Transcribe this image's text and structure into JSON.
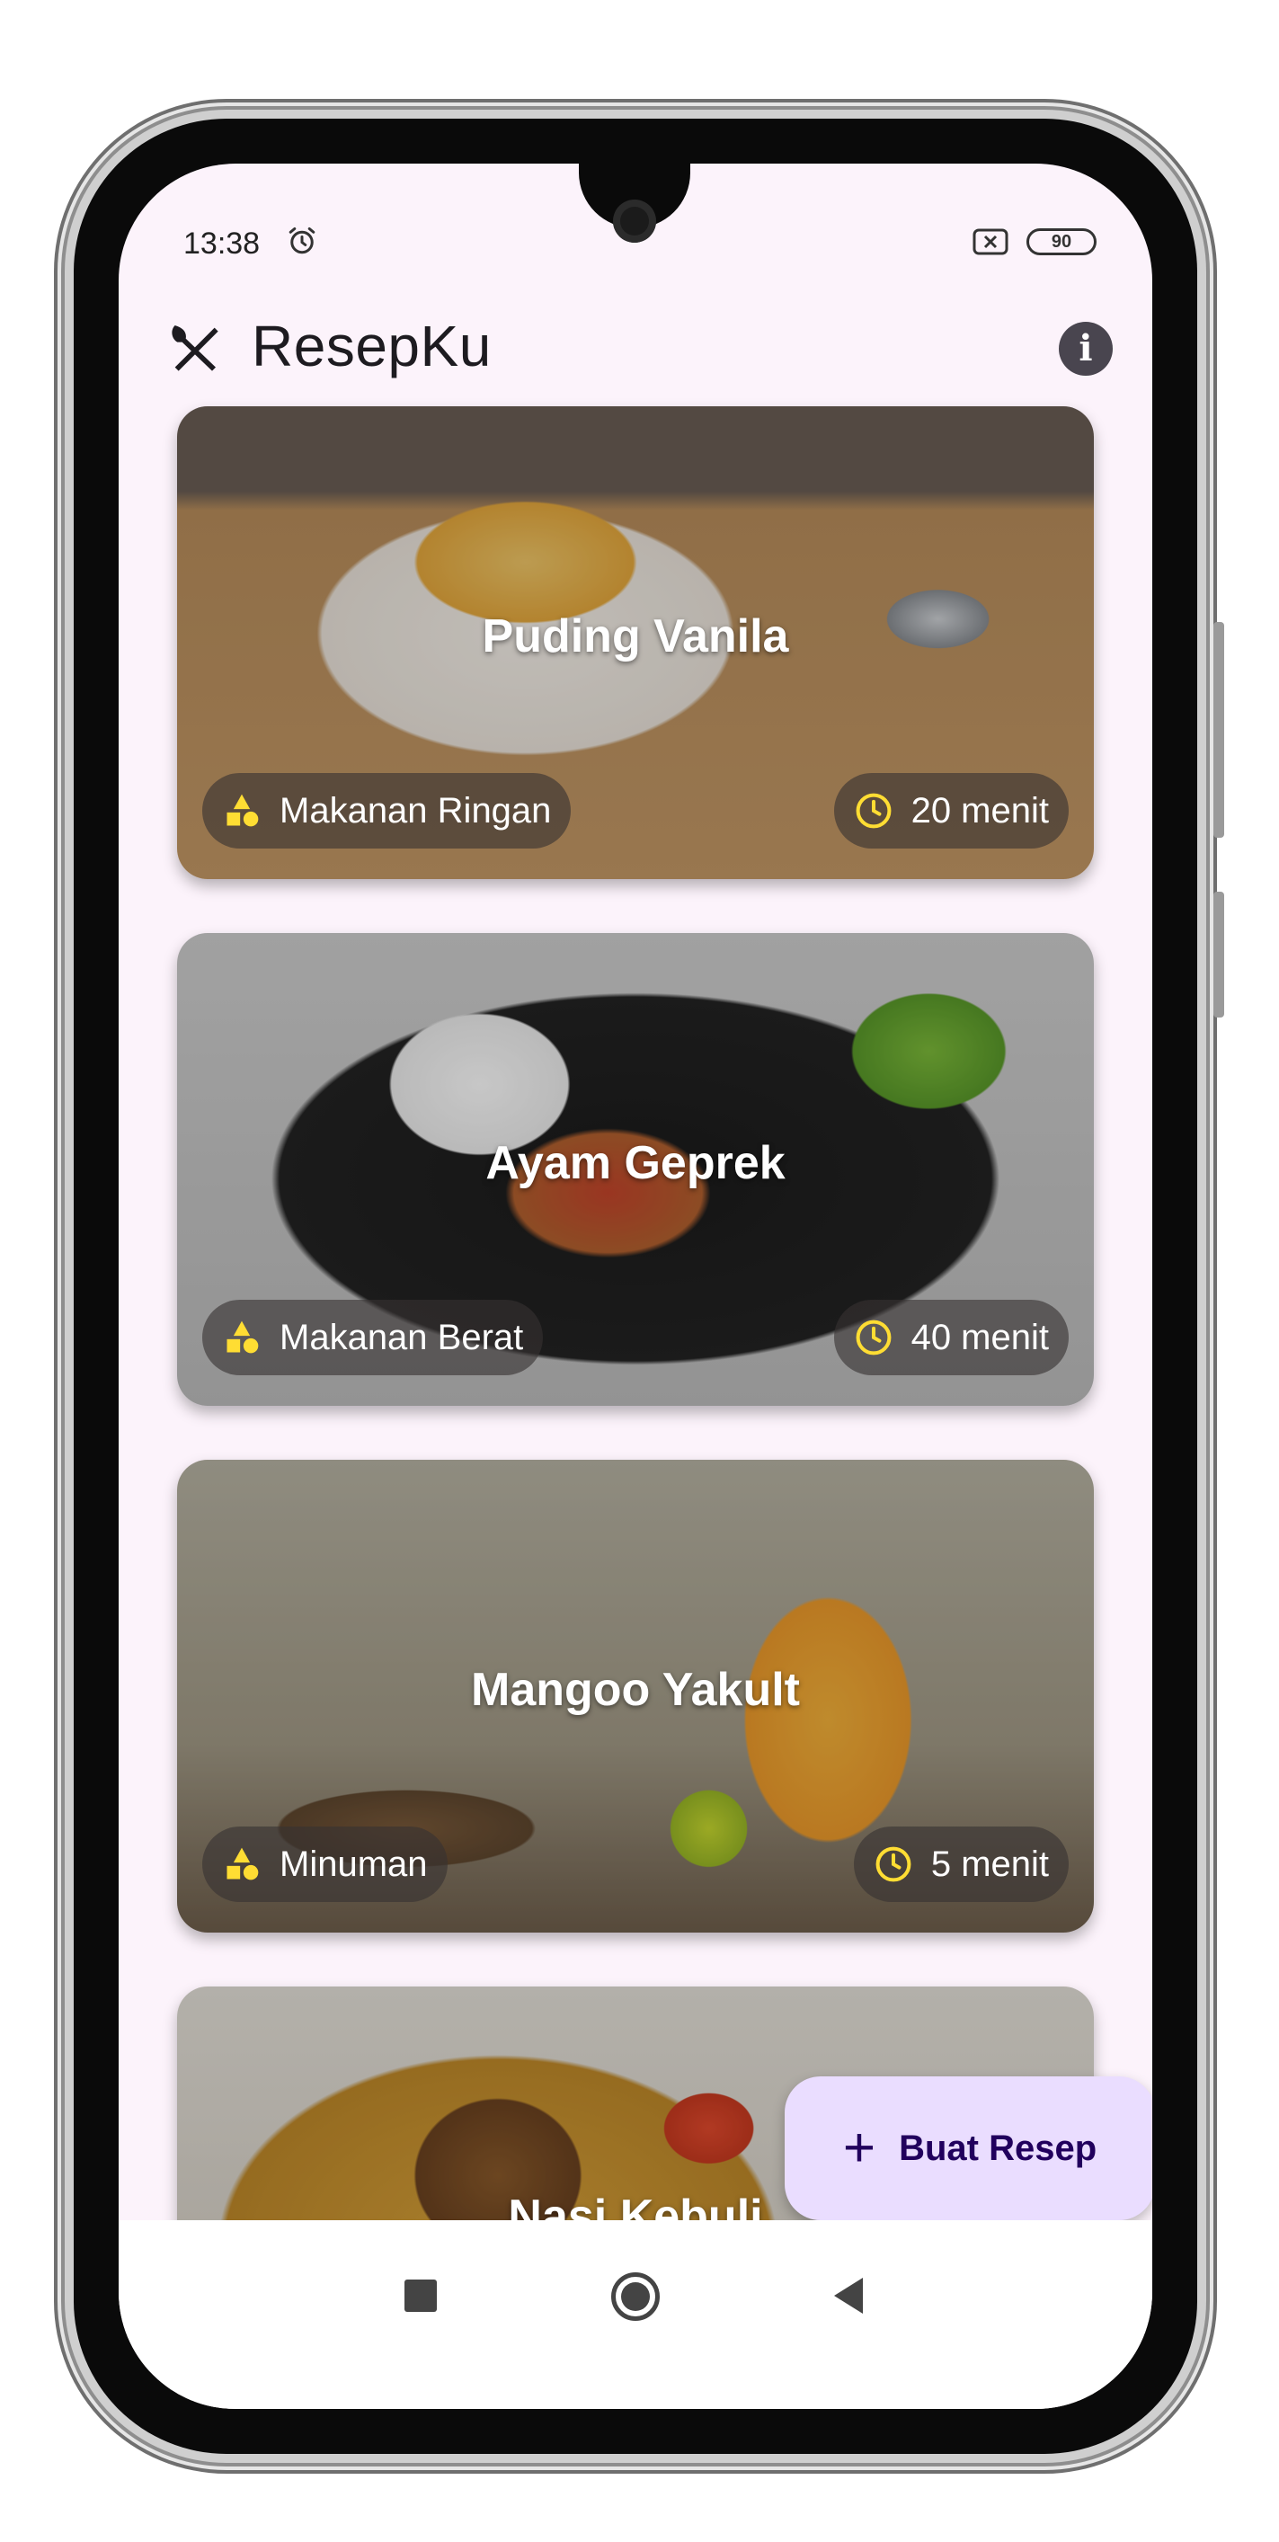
{
  "status_bar": {
    "time": "13:38",
    "battery": "90"
  },
  "app_bar": {
    "title": "ResepKu"
  },
  "recipes": [
    {
      "title": "Puding Vanila",
      "category": "Makanan Ringan",
      "duration": "20 menit"
    },
    {
      "title": "Ayam Geprek",
      "category": "Makanan Berat",
      "duration": "40 menit"
    },
    {
      "title": "Mangoo Yakult",
      "category": "Minuman",
      "duration": "5 menit"
    },
    {
      "title": "Nasi Kebuli",
      "category": "",
      "duration": ""
    }
  ],
  "fab": {
    "label": "Buat Resep"
  },
  "colors": {
    "background": "#fcf3fb",
    "fab": "#eaddff",
    "fab_text": "#21005d",
    "chip_icon": "#ffdd33"
  }
}
